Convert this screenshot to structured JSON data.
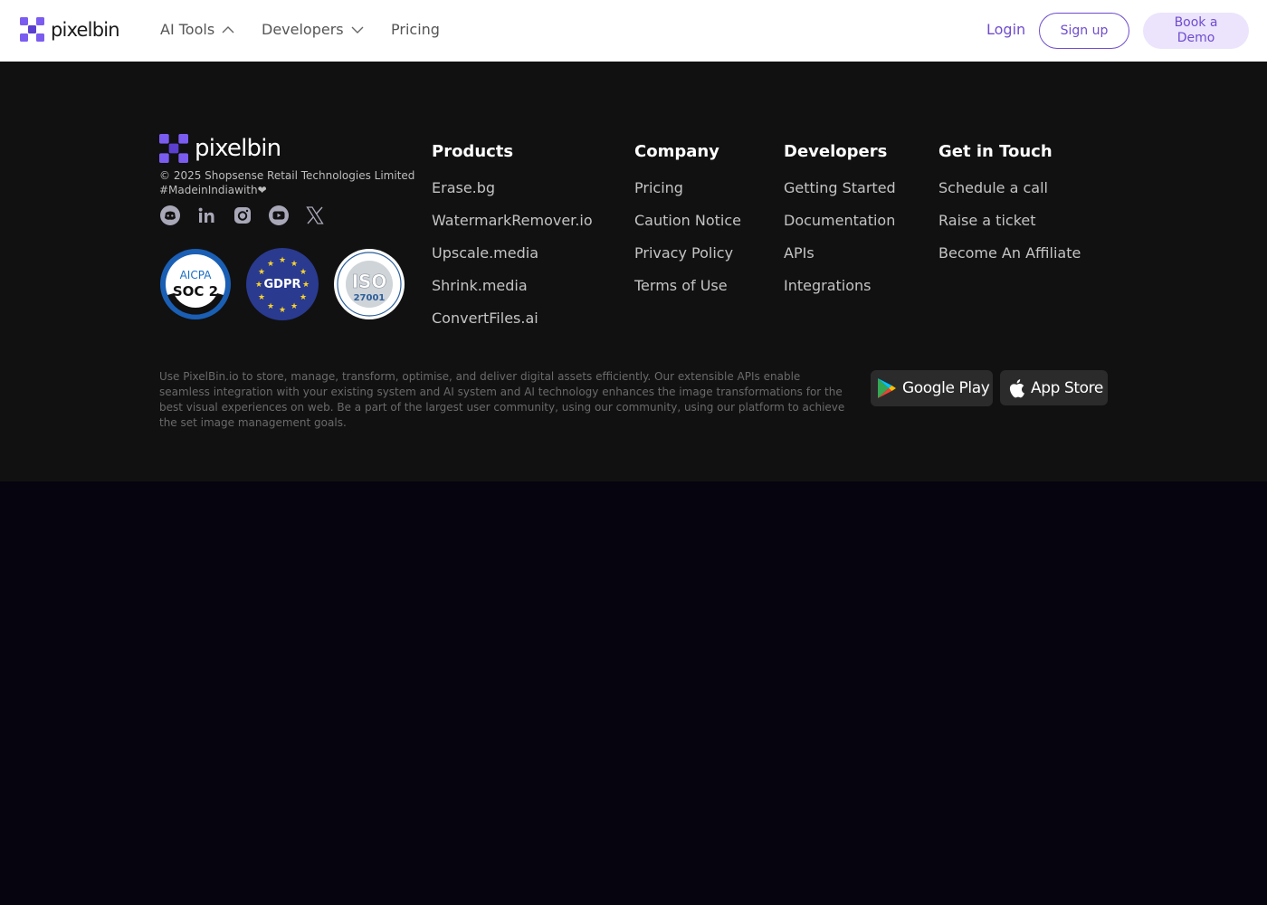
{
  "brand": {
    "name": "pixelbin",
    "accent": "#6f4ccf",
    "logo_gradient": [
      "#7b5cf0",
      "#5b3fd0"
    ]
  },
  "nav": {
    "items": [
      {
        "label": "AI Tools",
        "icon": "chevron-up-icon"
      },
      {
        "label": "Developers",
        "icon": "chevron-down-icon"
      },
      {
        "label": "Pricing"
      }
    ],
    "login": "Login",
    "signup": "Sign up",
    "demo_line1": "Book a",
    "demo_line2": "Demo"
  },
  "footer": {
    "copyright": "© 2025 Shopsense Retail Technologies Limited",
    "tagline": "#MadeinIndiawith❤",
    "socials": [
      "discord-icon",
      "linkedin-icon",
      "instagram-icon",
      "youtube-icon",
      "x-icon"
    ],
    "badges": [
      {
        "name": "soc2-badge",
        "top": "AICPA",
        "main": "SOC 2"
      },
      {
        "name": "gdpr-badge",
        "main": "GDPR"
      },
      {
        "name": "iso-badge",
        "main": "ISO",
        "sub": "27001"
      }
    ],
    "columns": [
      {
        "title": "Products",
        "links": [
          "Erase.bg",
          "WatermarkRemover.io",
          "Upscale.media",
          "Shrink.media",
          "ConvertFiles.ai"
        ]
      },
      {
        "title": "Company",
        "links": [
          "Pricing",
          "Caution Notice",
          "Privacy Policy",
          "Terms of Use"
        ]
      },
      {
        "title": "Developers",
        "links": [
          "Getting Started",
          "Documentation",
          "APIs",
          "Integrations"
        ]
      },
      {
        "title": "Get in Touch",
        "links": [
          "Schedule a call",
          "Raise a ticket",
          "Become An Affiliate"
        ]
      }
    ],
    "description": "Use PixelBin.io to store, manage, transform, optimise, and deliver digital assets efficiently. Our extensible APIs enable seamless integration with your existing system and AI system and AI technology enhances the image transformations for the best visual experiences on web. Be a part of the largest user community, using our community, using our platform to achieve the set image management goals.",
    "stores": {
      "google_play": "Google Play",
      "app_store": "App Store"
    }
  }
}
